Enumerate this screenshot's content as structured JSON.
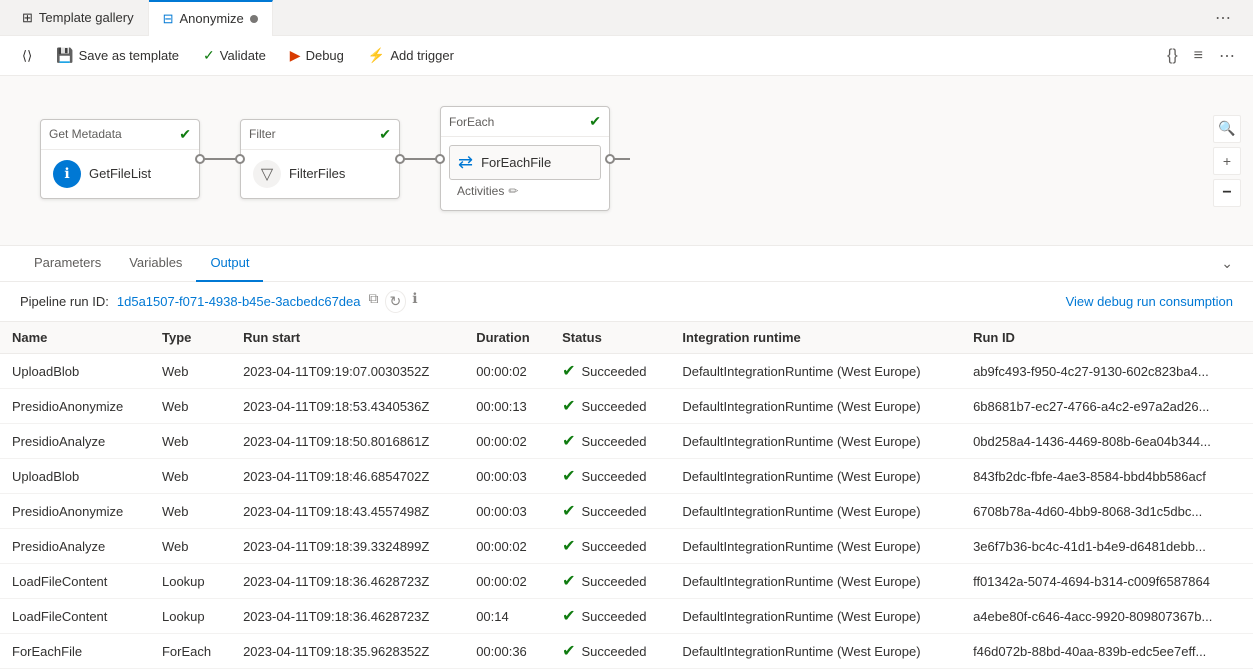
{
  "tabs": [
    {
      "label": "Template gallery",
      "icon": "grid",
      "active": false
    },
    {
      "label": "Anonymize",
      "icon": "pipeline",
      "active": true,
      "dirty": true
    }
  ],
  "tabbar_right": {
    "more_icon": "⋯"
  },
  "toolbar": {
    "save_label": "Save as template",
    "validate_label": "Validate",
    "debug_label": "Debug",
    "trigger_label": "Add trigger"
  },
  "pipeline": {
    "activities": [
      {
        "id": "get_metadata",
        "header": "Get Metadata",
        "icon": "ℹ",
        "icon_type": "blue",
        "name": "GetFileList",
        "check": true
      },
      {
        "id": "filter",
        "header": "Filter",
        "icon": "▽",
        "icon_type": "gray",
        "name": "FilterFiles",
        "check": true
      },
      {
        "id": "foreach",
        "header": "ForEach",
        "inner_name": "ForEachFile",
        "inner_icon": "⇄",
        "activities_label": "Activities",
        "check": true
      }
    ]
  },
  "output_panel": {
    "tabs": [
      {
        "label": "Parameters",
        "active": false
      },
      {
        "label": "Variables",
        "active": false
      },
      {
        "label": "Output",
        "active": true
      }
    ],
    "run_id_label": "Pipeline run ID:",
    "run_id_value": "1d5a1507-f071-4938-b45e-3acbedc67dea",
    "view_link": "View debug run consumption",
    "columns": [
      "Name",
      "Type",
      "Run start",
      "Duration",
      "Status",
      "Integration runtime",
      "Run ID"
    ],
    "rows": [
      {
        "name": "UploadBlob",
        "type": "Web",
        "run_start": "2023-04-11T09:19:07.0030352Z",
        "duration": "00:00:02",
        "status": "Succeeded",
        "integration_runtime": "DefaultIntegrationRuntime (West Europe)",
        "run_id": "ab9fc493-f950-4c27-9130-602c823ba4..."
      },
      {
        "name": "PresidioAnonymize",
        "type": "Web",
        "run_start": "2023-04-11T09:18:53.4340536Z",
        "duration": "00:00:13",
        "status": "Succeeded",
        "integration_runtime": "DefaultIntegrationRuntime (West Europe)",
        "run_id": "6b8681b7-ec27-4766-a4c2-e97a2ad26..."
      },
      {
        "name": "PresidioAnalyze",
        "type": "Web",
        "run_start": "2023-04-11T09:18:50.8016861Z",
        "duration": "00:00:02",
        "status": "Succeeded",
        "integration_runtime": "DefaultIntegrationRuntime (West Europe)",
        "run_id": "0bd258a4-1436-4469-808b-6ea04b344..."
      },
      {
        "name": "UploadBlob",
        "type": "Web",
        "run_start": "2023-04-11T09:18:46.6854702Z",
        "duration": "00:00:03",
        "status": "Succeeded",
        "integration_runtime": "DefaultIntegrationRuntime (West Europe)",
        "run_id": "843fb2dc-fbfe-4ae3-8584-bbd4bb586acf"
      },
      {
        "name": "PresidioAnonymize",
        "type": "Web",
        "run_start": "2023-04-11T09:18:43.4557498Z",
        "duration": "00:00:03",
        "status": "Succeeded",
        "integration_runtime": "DefaultIntegrationRuntime (West Europe)",
        "run_id": "6708b78a-4d60-4bb9-8068-3d1c5dbc..."
      },
      {
        "name": "PresidioAnalyze",
        "type": "Web",
        "run_start": "2023-04-11T09:18:39.3324899Z",
        "duration": "00:00:02",
        "status": "Succeeded",
        "integration_runtime": "DefaultIntegrationRuntime (West Europe)",
        "run_id": "3e6f7b36-bc4c-41d1-b4e9-d6481debb..."
      },
      {
        "name": "LoadFileContent",
        "type": "Lookup",
        "run_start": "2023-04-11T09:18:36.4628723Z",
        "duration": "00:00:02",
        "status": "Succeeded",
        "integration_runtime": "DefaultIntegrationRuntime (West Europe)",
        "run_id": "ff01342a-5074-4694-b314-c009f6587864"
      },
      {
        "name": "LoadFileContent",
        "type": "Lookup",
        "run_start": "2023-04-11T09:18:36.4628723Z",
        "duration": "00:14",
        "status": "Succeeded",
        "integration_runtime": "DefaultIntegrationRuntime (West Europe)",
        "run_id": "a4ebe80f-c646-4acc-9920-809807367b..."
      },
      {
        "name": "ForEachFile",
        "type": "ForEach",
        "run_start": "2023-04-11T09:18:35.9628352Z",
        "duration": "00:00:36",
        "status": "Succeeded",
        "integration_runtime": "DefaultIntegrationRuntime (West Europe)",
        "run_id": "f46d072b-88bd-40aa-839b-edc5ee7eff..."
      }
    ]
  }
}
